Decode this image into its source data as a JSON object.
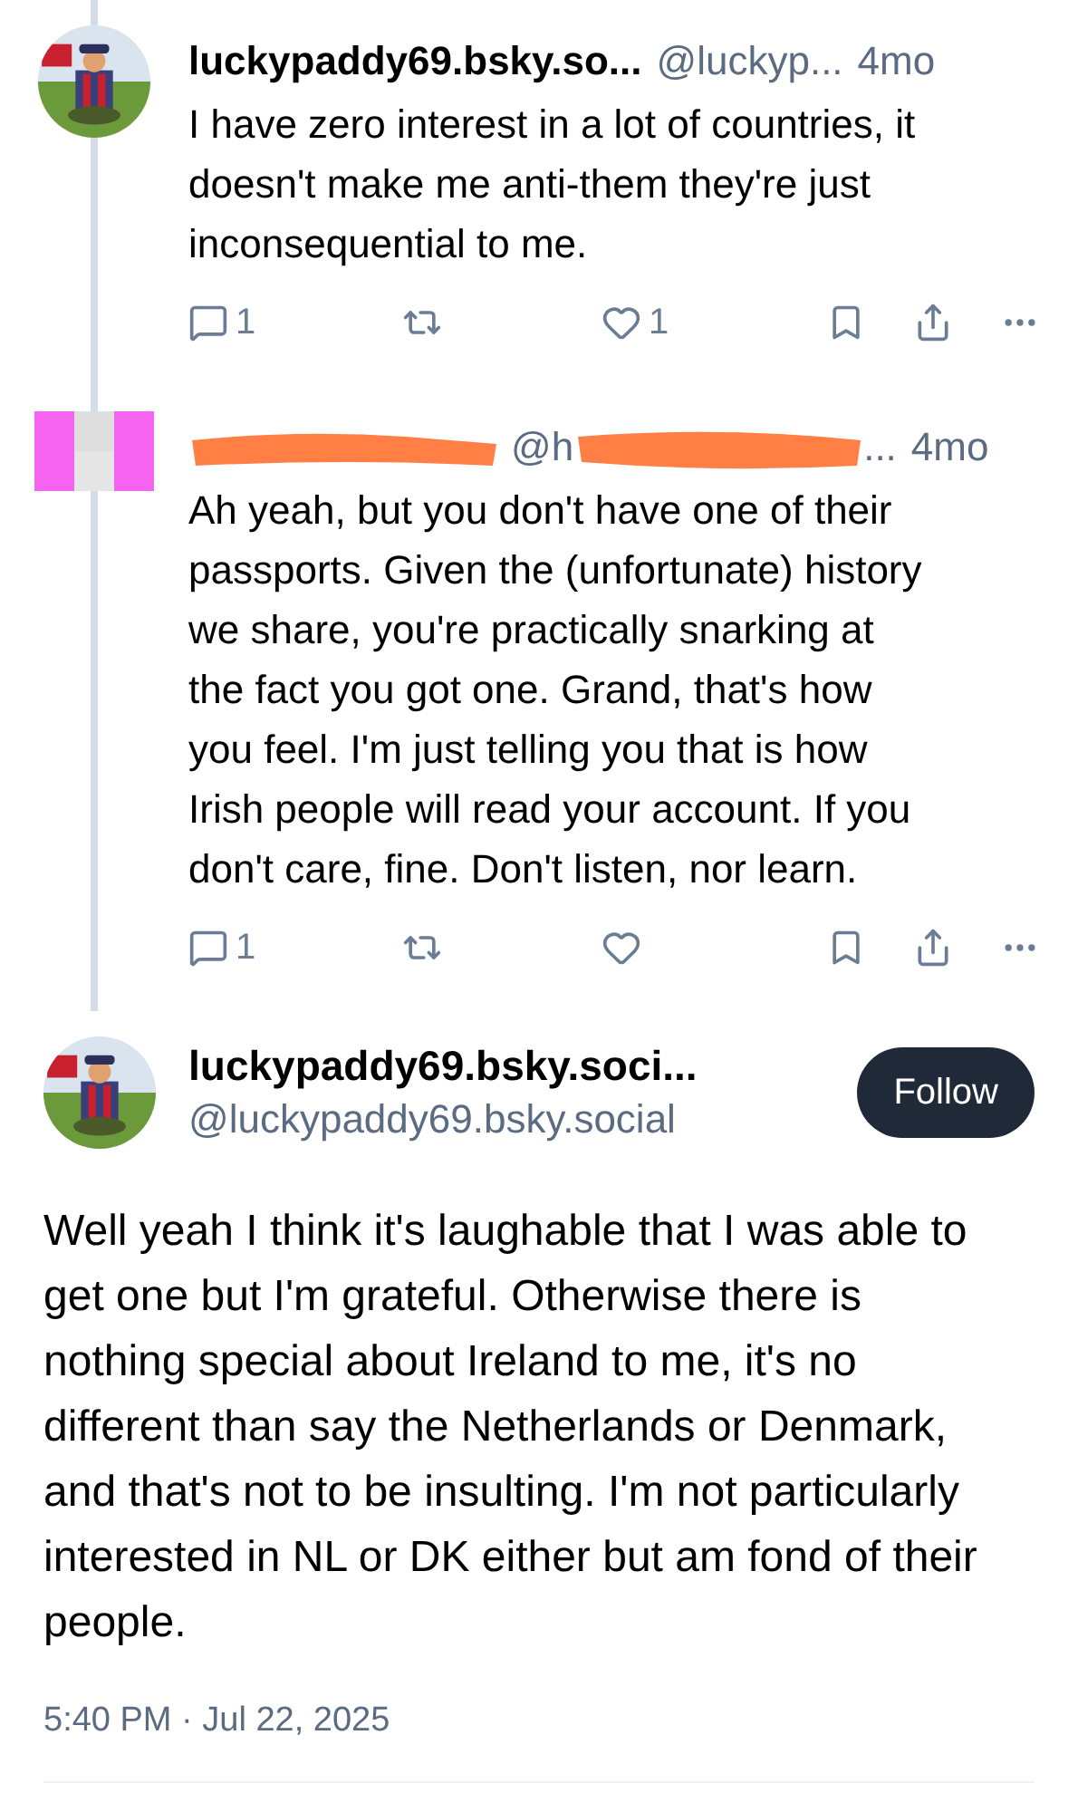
{
  "replies": [
    {
      "name": "luckypaddy69.bsky.so...",
      "handle": "@luckyp...",
      "time": "4mo",
      "redacted": false,
      "text": "I have zero interest in a lot of countries, it doesn't make me anti-them they're just inconsequential to me.",
      "counts": {
        "replies": "1",
        "likes": "1"
      }
    },
    {
      "handle": "@h",
      "handle_tail": "...",
      "time": "4mo",
      "redacted": true,
      "text": "Ah yeah, but you don't have one of their passports. Given the (unfortunate) history we share, you're practically snarking at the fact you got one. Grand, that's how you feel. I'm just telling you that is how Irish people will read your account. If you don't care, fine. Don't listen, nor learn.",
      "counts": {
        "replies": "1"
      }
    }
  ],
  "main": {
    "name": "luckypaddy69.bsky.soci...",
    "handle": "@luckypaddy69.bsky.social",
    "follow": "Follow",
    "text": "Well yeah I think it's laughable that I was able to get one but I'm grateful. Otherwise there is nothing special about Ireland to me, it's no different than say the Netherlands or Denmark, and that's not to be insulting. I'm not particularly interested in NL or DK either but am fond of their people.",
    "timestamp": "5:40 PM · Jul 22, 2025"
  }
}
